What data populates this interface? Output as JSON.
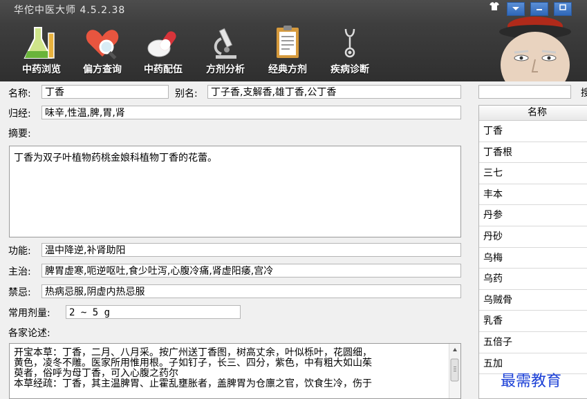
{
  "window": {
    "title": "华佗中医大师 4.5.2.38"
  },
  "toolbar": {
    "items": [
      {
        "label": "中药浏览",
        "icon": "flask-icon"
      },
      {
        "label": "偏方查询",
        "icon": "heart-search-icon"
      },
      {
        "label": "中药配伍",
        "icon": "pills-icon"
      },
      {
        "label": "方剂分析",
        "icon": "microscope-icon"
      },
      {
        "label": "经典方剂",
        "icon": "clipboard-icon"
      },
      {
        "label": "疾病诊断",
        "icon": "stethoscope-icon"
      }
    ]
  },
  "form": {
    "name_label": "名称:",
    "name_value": "丁香",
    "alias_label": "别名:",
    "alias_value": "丁子香,支解香,雄丁香,公丁香",
    "meridian_label": "归经:",
    "meridian_value": "味辛,性温,脾,胃,肾",
    "summary_label": "摘要:",
    "summary_value": "丁香为双子叶植物药桃金娘科植物丁香的花蕾。",
    "function_label": "功能:",
    "function_value": "温中降逆,补肾助阳",
    "indication_label": "主治:",
    "indication_value": "脾胃虚寒,呃逆呕吐,食少吐泻,心腹冷痛,肾虚阳痿,宫冷",
    "contra_label": "禁忌:",
    "contra_value": "热病忌服,阴虚内热忌服",
    "dose_label": "常用剂量:",
    "dose_value": "2 ~ 5 g",
    "discuss_label": "各家论述:",
    "discuss_lines": [
      "开宝本草：丁香，二月、八月采。按广州送丁香图，树高丈余，叶似栎叶，花圆细，",
      "黄色，凌冬不雕。医家所用惟用根。子如钉子，长三、四分，紫色，中有粗大如山茱",
      "萸者，俗呼为母丁香，可入心腹之药尔",
      "本草经疏：丁香，其主温脾胃、止霍乱壅胀者，盖脾胃为仓廪之官，饮食生冷，伤于"
    ]
  },
  "sidebar": {
    "search_value": "",
    "search_button_label": "搜",
    "column_header": "名称",
    "items": [
      "丁香",
      "丁香根",
      "三七",
      "丰本",
      "丹参",
      "丹砂",
      "乌梅",
      "乌药",
      "乌贼骨",
      "乳香",
      "五倍子",
      "五加"
    ]
  },
  "watermark": "最需教育"
}
